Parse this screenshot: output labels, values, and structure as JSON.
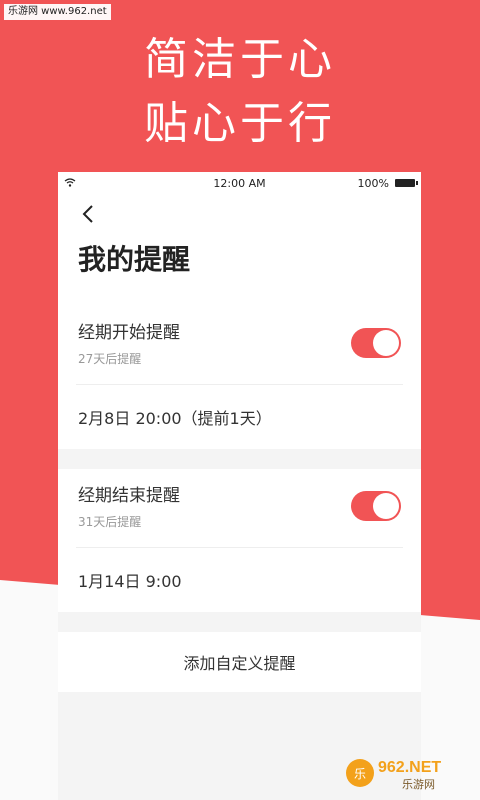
{
  "watermark": {
    "site": "乐游网 www.962.net"
  },
  "slogan": {
    "line1": "简洁于心",
    "line2": "贴心于行"
  },
  "status_bar": {
    "time": "12:00 AM",
    "battery": "100%"
  },
  "header": {
    "title": "我的提醒"
  },
  "reminders": [
    {
      "title": "经期开始提醒",
      "subtitle": "27天后提醒",
      "enabled": true,
      "time": "2月8日  20:00（提前1天）"
    },
    {
      "title": "经期结束提醒",
      "subtitle": "31天后提醒",
      "enabled": true,
      "time": "1月14日  9:00"
    }
  ],
  "add_button": {
    "label": "添加自定义提醒"
  },
  "brand_logo": {
    "text": "962.NET",
    "subtext": "乐游网"
  },
  "colors": {
    "accent": "#f15455",
    "background": "#fafafa",
    "card": "#ffffff"
  }
}
